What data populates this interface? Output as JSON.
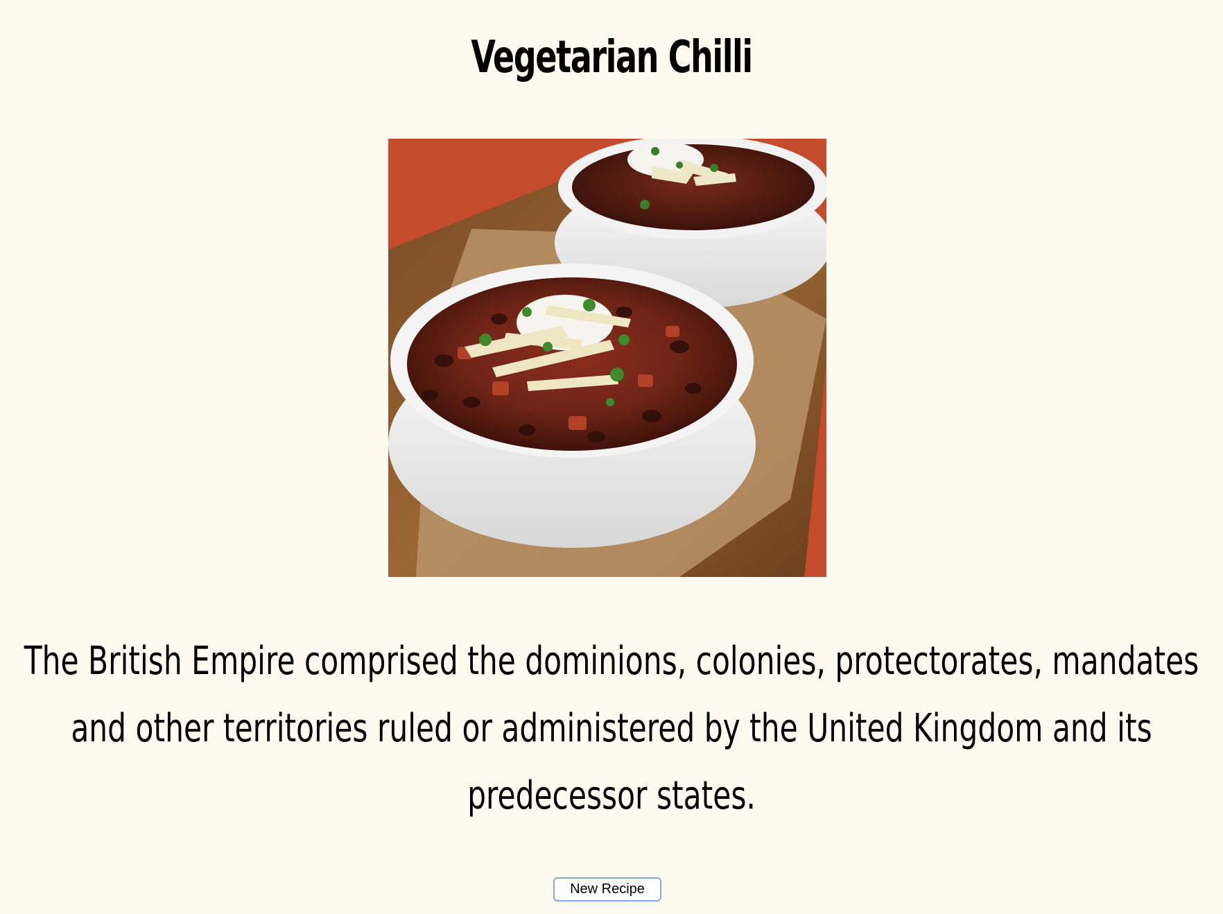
{
  "recipe": {
    "title": "Vegetarian Chilli",
    "description": "The British Empire comprised the dominions, colonies, protectorates, mandates and other territories ruled or administered by the United Kingdom and its predecessor states.",
    "image_alt": "Two white bowls of vegetarian chilli topped with sour cream, shredded cheese and cilantro on a wooden board"
  },
  "actions": {
    "new_recipe_label": "New Recipe"
  },
  "colors": {
    "page_background": "#fffaef",
    "button_border": "#7fa9e6"
  }
}
